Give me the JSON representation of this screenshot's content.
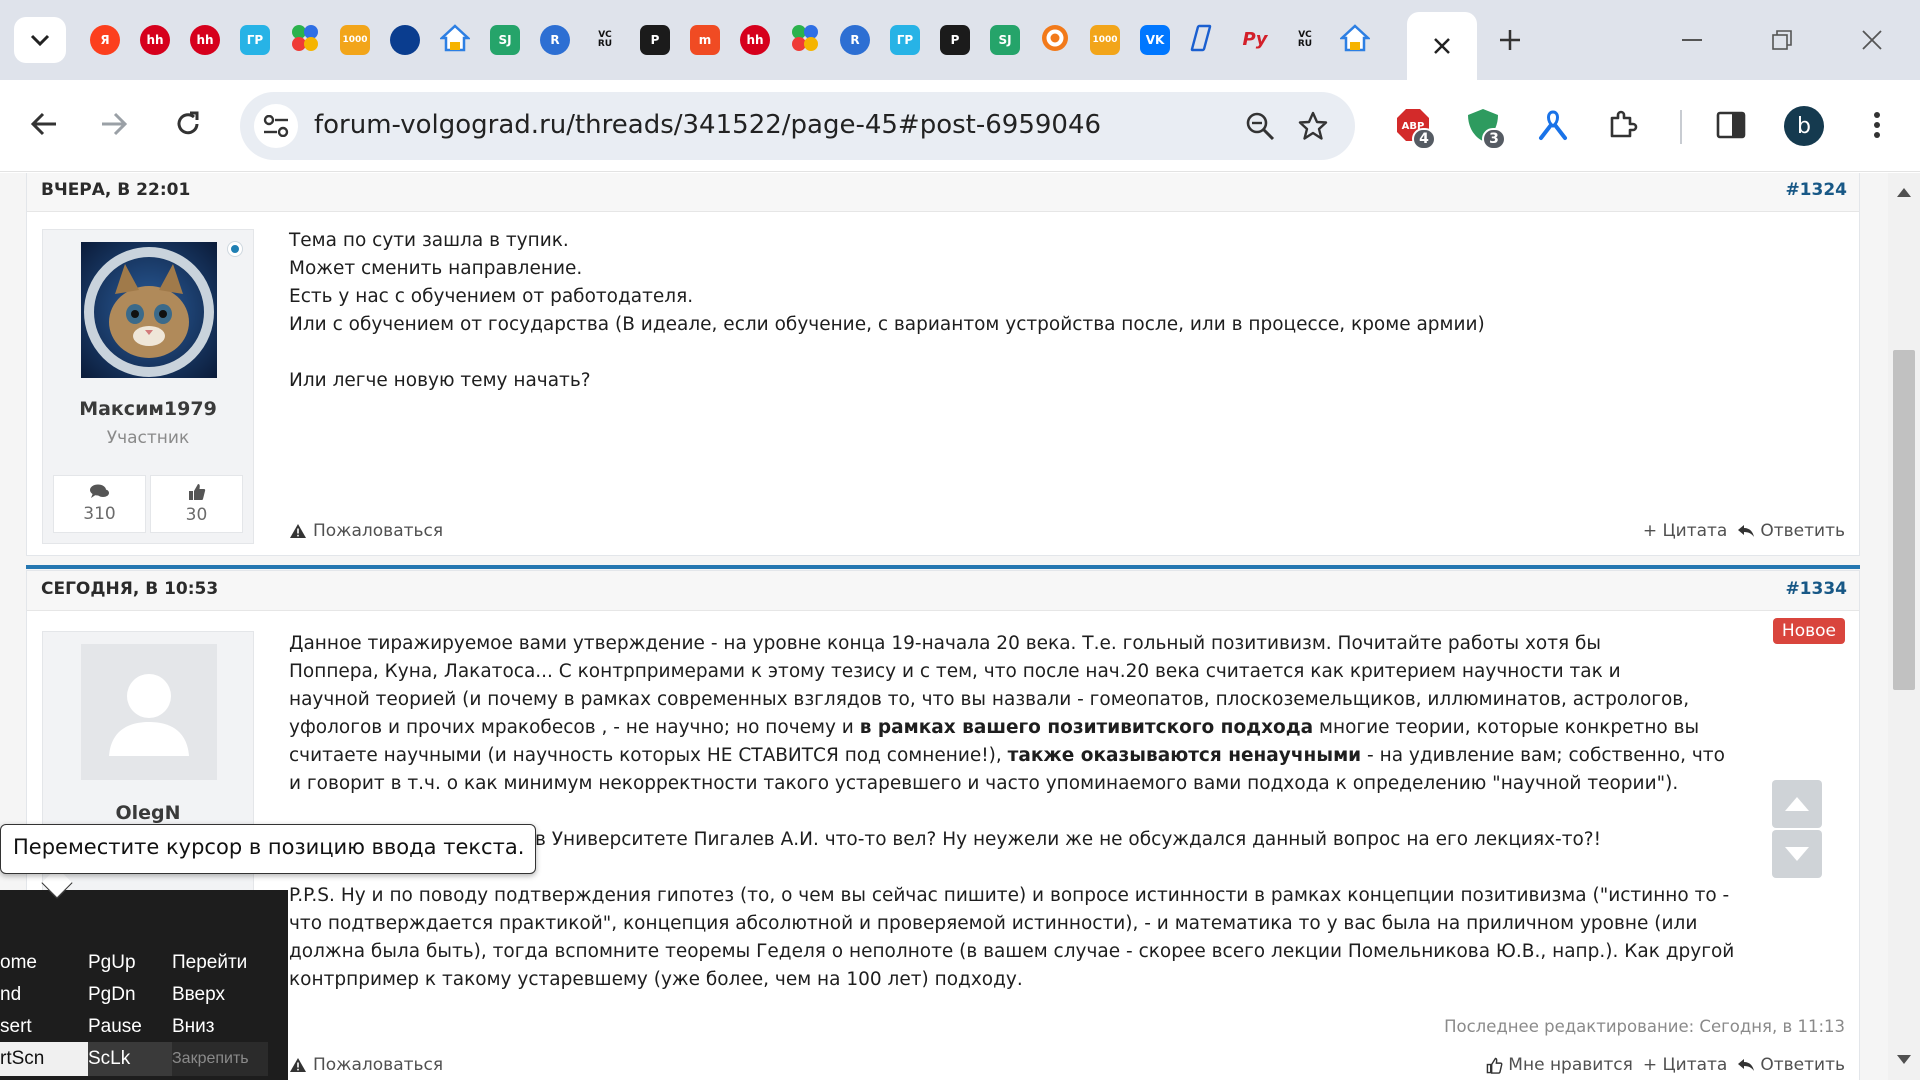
{
  "browser": {
    "tab_favicons": [
      {
        "name": "yandex-icon",
        "text": "Я",
        "bg": "#fc3f1d",
        "shape": "circle"
      },
      {
        "name": "hh-icon",
        "text": "hh",
        "bg": "#d6001c",
        "shape": "circle"
      },
      {
        "name": "hh-icon",
        "text": "hh",
        "bg": "#d6001c",
        "shape": "circle"
      },
      {
        "name": "gr-icon",
        "text": "ГР",
        "bg": "#27b3e6",
        "shape": "square"
      },
      {
        "name": "dots-icon",
        "text": "",
        "bg": "",
        "shape": "dots"
      },
      {
        "name": "1000-icon",
        "text": "1000",
        "bg": "#f2a51a",
        "shape": "square"
      },
      {
        "name": "globe-icon",
        "text": "",
        "bg": "#0a3d8f",
        "shape": "circle"
      },
      {
        "name": "house-icon",
        "text": "",
        "bg": "#ffffff",
        "shape": "house"
      },
      {
        "name": "sj-icon",
        "text": "SJ",
        "bg": "#25a46a",
        "shape": "square"
      },
      {
        "name": "r-icon",
        "text": "R",
        "bg": "#2d6fd3",
        "shape": "circle"
      },
      {
        "name": "vc-icon",
        "text": "VC\nRU",
        "bg": "#ffffff",
        "shape": "vc"
      },
      {
        "name": "p-icon",
        "text": "P",
        "bg": "#1b1b1b",
        "shape": "square"
      },
      {
        "name": "m-icon",
        "text": "m",
        "bg": "#f04b23",
        "shape": "square"
      },
      {
        "name": "hh-icon",
        "text": "hh",
        "bg": "#d6001c",
        "shape": "circle"
      },
      {
        "name": "dots-icon",
        "text": "",
        "bg": "",
        "shape": "dots"
      },
      {
        "name": "r-icon",
        "text": "R",
        "bg": "#2d6fd3",
        "shape": "circle"
      },
      {
        "name": "gr-icon",
        "text": "ГР",
        "bg": "#27b3e6",
        "shape": "square"
      },
      {
        "name": "p-icon",
        "text": "P",
        "bg": "#1b1b1b",
        "shape": "square"
      },
      {
        "name": "sj-icon",
        "text": "SJ",
        "bg": "#25a46a",
        "shape": "square"
      },
      {
        "name": "target-icon",
        "text": "",
        "bg": "#f27a1a",
        "shape": "target"
      },
      {
        "name": "1000-icon",
        "text": "1000",
        "bg": "#f2a51a",
        "shape": "square"
      },
      {
        "name": "vk-icon",
        "text": "VK",
        "bg": "#0077ff",
        "shape": "square"
      },
      {
        "name": "slash-icon",
        "text": "",
        "bg": "#1a5fd0",
        "shape": "slash"
      },
      {
        "name": "ru-icon",
        "text": "Pу",
        "bg": "#ffffff",
        "shape": "ru"
      },
      {
        "name": "vc-icon",
        "text": "VC\nRU",
        "bg": "#ffffff",
        "shape": "vc"
      },
      {
        "name": "house-icon",
        "text": "",
        "bg": "#ffffff",
        "shape": "house"
      }
    ],
    "url": "forum-volgograd.ru/threads/341522/page-45#post-6959046",
    "ext_badges": [
      "4",
      "3"
    ],
    "profile_initial": "b"
  },
  "posts": [
    {
      "date": "ВЧЕРА, В 22:01",
      "number": "#1324",
      "username": "Максим1979",
      "usertitle": "Участник",
      "messages_count": "310",
      "likes_count": "30",
      "lines": [
        "Тема по сути зашла в тупик.",
        "Может сменить направление.",
        "Есть у нас с обучением от работодателя.",
        "Или с обучением от государства (В идеале, если обучение, с вариантом устройства после, или в процессе, кроме армии)",
        "",
        "Или легче новую тему начать?"
      ],
      "report": "Пожаловаться",
      "quote": "+ Цитата",
      "reply": "Ответить"
    },
    {
      "date": "СЕГОДНЯ, В 10:53",
      "number": "#1334",
      "username": "OlegN",
      "new_badge": "Новое",
      "para1_line1": "Данное тиражируемое вами утверждение - на уровне конца 19-начала 20 века. Т.е. гольный позитивизм. Почитайте работы хотя бы",
      "para1_line2": "Поппера, Куна, Лакатоса... С контрпримерами к этому тезису и с тем, что после нач.20 века считается как критерием научности так и",
      "para1_line3": "научной теорией (и почему в рамках современных взглядов то, что вы назвали - гомеопатов, плоскоземельщиков, иллюминатов, астрологов,",
      "para1_line4_a": "уфологов и прочих мракобесов , - не научно; но почему и ",
      "para1_line4_bold": "в рамках вашего позитивитского подхода",
      "para1_line4_b": " многие теории, которые конкретно вы",
      "para1_line5_a": "считаете научными (и научность которых НЕ СТАВИТСЯ под сомнение!), ",
      "para1_line5_bold": "также оказываются ненаучными",
      "para1_line5_b": " - на удивление вам; собственно, что",
      "para1_line6": "и говорит в т.ч. о как минимум некорректности такого устаревшего и часто упоминаемого вами подхода к определению \"научной теории\").",
      "para2": "в Университете Пигалев А.И. что-то вел? Ну неужели же не обсуждался данный вопрос на его лекциях-то?!",
      "para3_line1": "P.P.S. Ну и по поводу подтверждения гипотез (то, о чем вы сейчас пишите) и вопросе истинности в рамках концепции позитивизма (\"истинно то -",
      "para3_line2": "что подтверждается практикой\", концепция абсолютной и проверяемой истинности), - и математика то у вас была на приличном уровне (или",
      "para3_line3": "должна была быть), тогда вспомните теоремы Геделя о неполноте (в вашем случае - скорее всего лекции Помельникова Ю.В., напр.). Как другой",
      "para3_line4": "контрпример к такому устаревшему (уже более, чем на 100 лет) подходу.",
      "edited": "Последнее редактирование: Сегодня, в 11:13",
      "report": "Пожаловаться",
      "like": "Мне нравится",
      "quote": "+ Цитата",
      "reply": "Ответить"
    }
  ],
  "tooltip": "Переместите курсор в позицию ввода текста.",
  "osk": {
    "keys": [
      [
        "ome",
        "PgUp",
        "Перейти"
      ],
      [
        "nd",
        "PgDn",
        "Вверх"
      ],
      [
        "sert",
        "Pause",
        "Вниз"
      ],
      [
        "rtScn",
        "ScLk",
        "Закрепить"
      ]
    ]
  },
  "colors": {
    "accent_blue": "#2577b1",
    "post_number": "#185886",
    "new_badge": "#d9453d"
  }
}
